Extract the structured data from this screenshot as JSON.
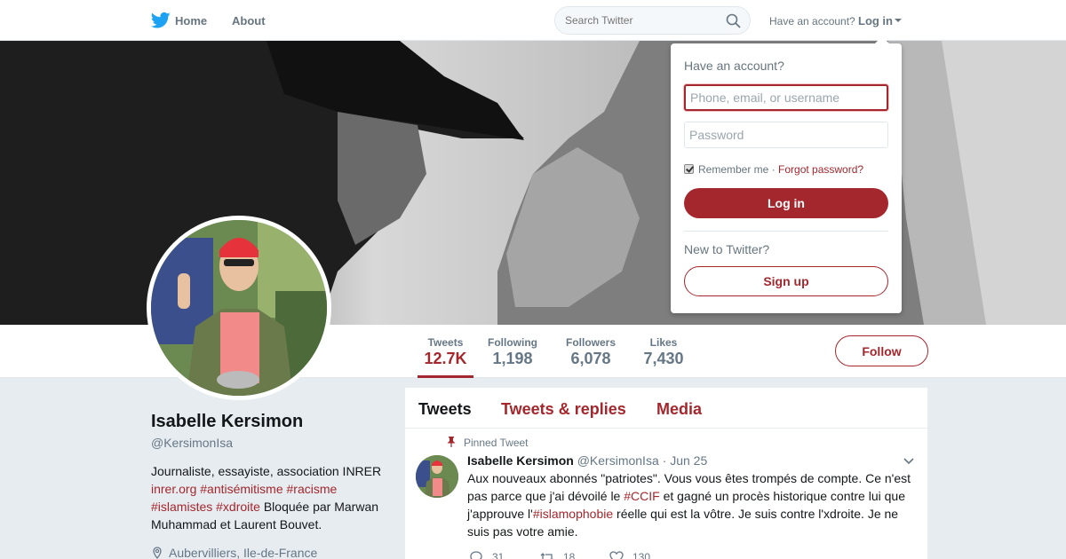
{
  "nav": {
    "home_label": "Home",
    "about_label": "About",
    "search_placeholder": "Search Twitter",
    "have_account": "Have an account?",
    "login_label": "Log in"
  },
  "profile_nav": {
    "stats": [
      {
        "label": "Tweets",
        "value": "12.7K"
      },
      {
        "label": "Following",
        "value": "1,198"
      },
      {
        "label": "Followers",
        "value": "6,078"
      },
      {
        "label": "Likes",
        "value": "7,430"
      }
    ],
    "follow_label": "Follow"
  },
  "profile": {
    "name": "Isabelle Kersimon",
    "handle": "@KersimonIsa",
    "bio_text1": "Journaliste, essayiste, association INRER ",
    "bio_link1": "inrer.org",
    "bio_tag1": "#antisémitisme",
    "bio_tag2": "#racisme",
    "bio_tag3": "#islamistes",
    "bio_tag4": "#xdroite",
    "bio_text2": " Bloquée par Marwan Muhammad et Laurent Bouvet.",
    "location": "Aubervilliers, Ile-de-France"
  },
  "timeline": {
    "tabs": [
      "Tweets",
      "Tweets & replies",
      "Media"
    ],
    "pinned_label": "Pinned Tweet",
    "tweet": {
      "name": "Isabelle Kersimon",
      "handle": "@KersimonIsa",
      "date": "· Jun 25",
      "text1": "Aux nouveaux abonnés \"patriotes\". Vous vous êtes trompés de compte. Ce n'est pas parce que j'ai dévoilé le ",
      "link1": "#CCIF",
      "text2": " et gagné un procès historique contre lui que j'approuve l'",
      "link2": "#islamophobie",
      "text3": " réelle qui est la vôtre. Je suis contre l'xdroite. Je ne suis pas votre amie.",
      "replies": "31",
      "retweets": "18",
      "likes": "130"
    }
  },
  "login_dropdown": {
    "title": "Have an account?",
    "username_placeholder": "Phone, email, or username",
    "password_placeholder": "Password",
    "remember_label": "Remember me",
    "separator": " · ",
    "forgot_label": "Forgot password?",
    "login_button": "Log in",
    "new_label": "New to Twitter?",
    "signup_button": "Sign up"
  },
  "colors": {
    "accent": "#a4272d",
    "muted": "#657786",
    "background": "#e6ecf0",
    "brand": "#1da1f2"
  },
  "icons": [
    "twitter-bird-icon",
    "search-icon",
    "caret-down-icon",
    "pin-icon",
    "location-icon",
    "chevron-down-icon",
    "reply-icon",
    "retweet-icon",
    "heart-icon"
  ]
}
